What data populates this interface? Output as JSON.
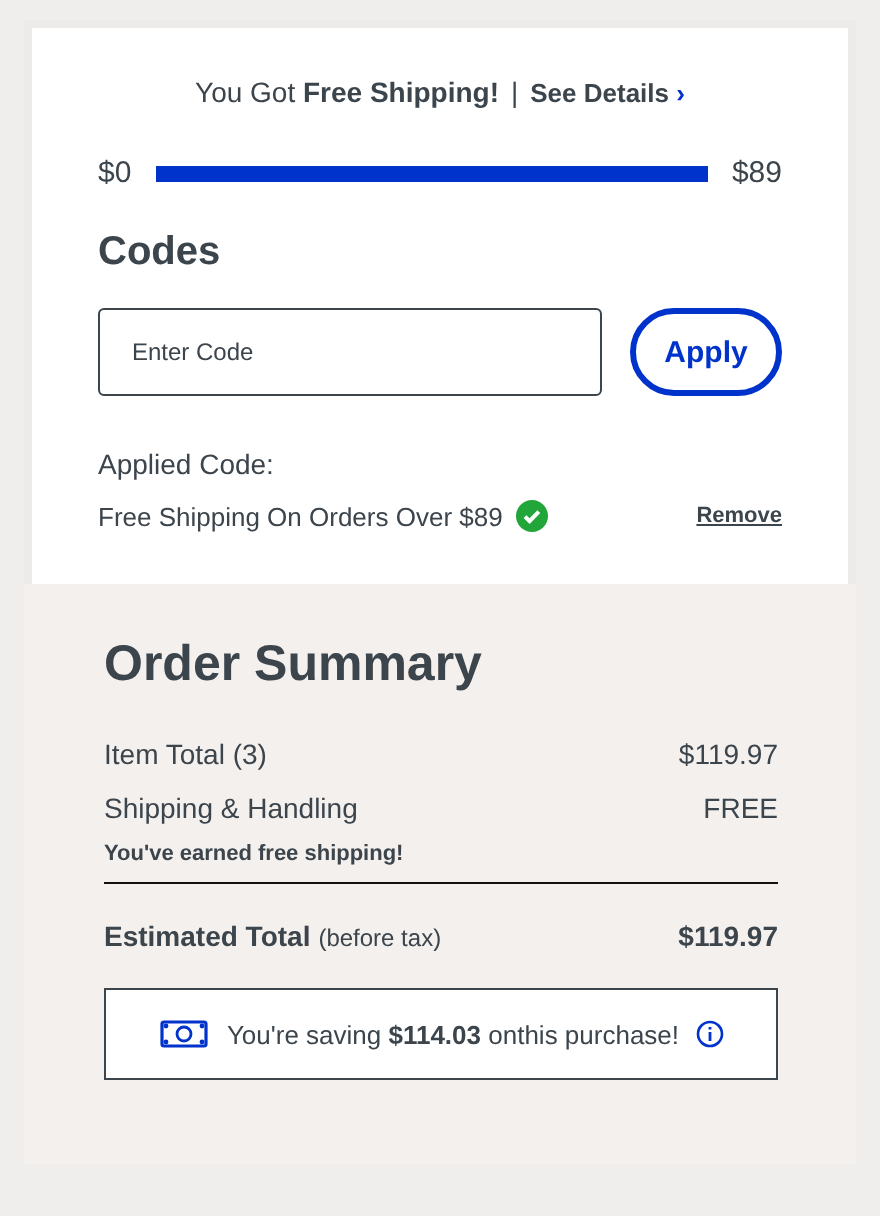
{
  "shipping_banner": {
    "text": "You Got **Free Shipping!**",
    "separator": "|",
    "link": "See Details",
    "link_icon": "›"
  },
  "progress": {
    "start_label": "$0",
    "end_label": "$89",
    "level": 1
  },
  "codes": {
    "title": "Codes",
    "input": {
      "placeholder": "Enter Code"
    },
    "apply_button": "Apply",
    "applied_label": "Applied Code:",
    "applied_code": "Free Shipping On Orders Over $89",
    "applied_valid": true,
    "remove_link": "Remove"
  },
  "order_summary": {
    "title": "Order Summary",
    "rows": [
      {
        "label": "Item Total (3)",
        "value": "$119.97"
      },
      {
        "label": "Shipping & Handling",
        "value": "FREE",
        "note": "You've earned free shipping!"
      }
    ],
    "total": {
      "label": "Estimated Total",
      "qualifier": "(before tax)",
      "value": "$119.97"
    },
    "savings": {
      "text": "You're saving **$114.03** onthis purchase!"
    }
  }
}
